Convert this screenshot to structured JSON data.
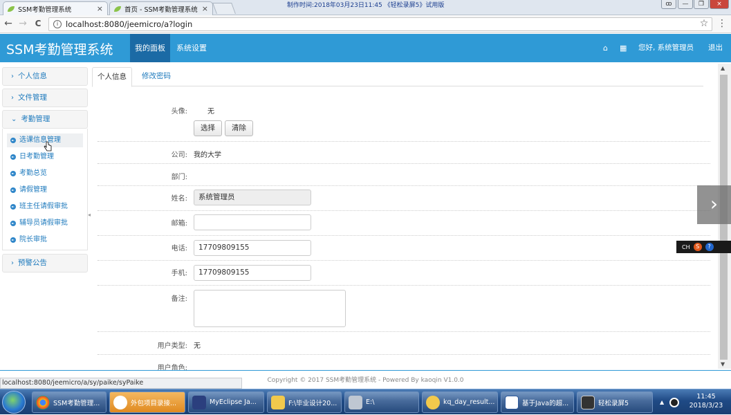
{
  "browser": {
    "tabs": [
      {
        "title": "SSM考勤管理系统",
        "close": "×"
      },
      {
        "title": "首页 - SSM考勤管理系统",
        "close": "×"
      }
    ],
    "recorder_banner": "制作时间:2018年03月23日11:45  《轻松录屏5》试用版",
    "window_buttons": {
      "user": "ꝏ",
      "minimize": "—",
      "restore": "❐",
      "close": "×"
    },
    "url": "localhost:8080/jeemicro/a?login",
    "star": "☆",
    "menu": "⋮",
    "back": "←",
    "forward": "→",
    "reload": "C",
    "info": "i"
  },
  "header": {
    "app_title": "SSM考勤管理系统",
    "nav": {
      "dashboard": "我的面板",
      "settings": "系统设置"
    },
    "home_icon": "⌂",
    "grid_icon": "▦",
    "greeting": "您好, 系统管理员",
    "logout": "退出"
  },
  "sidebar": {
    "groups": {
      "personal": "个人信息",
      "files": "文件管理",
      "attendance": "考勤管理",
      "warning": "预警公告"
    },
    "chev_right": "›",
    "chev_down": "⌄",
    "attendance_items": [
      "选课信息管理",
      "日考勤管理",
      "考勤总览",
      "请假管理",
      "班主任请假审批",
      "辅导员请假审批",
      "院长审批"
    ]
  },
  "content": {
    "tabs": {
      "info": "个人信息",
      "password": "修改密码"
    },
    "form": {
      "avatar_label": "头像:",
      "avatar_value": "无",
      "select_btn": "选择",
      "clear_btn": "清除",
      "company_label": "公司:",
      "company_value": "我的大学",
      "dept_label": "部门:",
      "name_label": "姓名:",
      "name_value": "系统管理员",
      "email_label": "邮箱:",
      "email_value": "",
      "phone_label": "电话:",
      "phone_value": "17709809155",
      "mobile_label": "手机:",
      "mobile_value": "17709809155",
      "remarks_label": "备注:",
      "remarks_value": "",
      "usertype_label": "用户类型:",
      "usertype_value": "无",
      "role_label": "用户角色:"
    }
  },
  "footer": {
    "text": "Copyright © 2017 SSM考勤管理系统 - Powered By kaoqin V1.0.0"
  },
  "status_url": "localhost:8080/jeemicro/a/sy/paike/syPaike",
  "overlay": {
    "next": "›",
    "ime": "CH"
  },
  "taskbar": {
    "items": [
      "SSM考勤管理...",
      "外包项目录接...",
      "MyEclipse Ja...",
      "F:\\毕业设计20...",
      "E:\\",
      "kq_day_result...",
      "基于Java的超...",
      "轻松录屏5"
    ],
    "tray_arrow": "▲",
    "time": "11:45",
    "date": "2018/3/23"
  },
  "colors": {
    "header": "#2f9ad6",
    "active_nav": "#1b6aa5",
    "link": "#1e7abd"
  }
}
